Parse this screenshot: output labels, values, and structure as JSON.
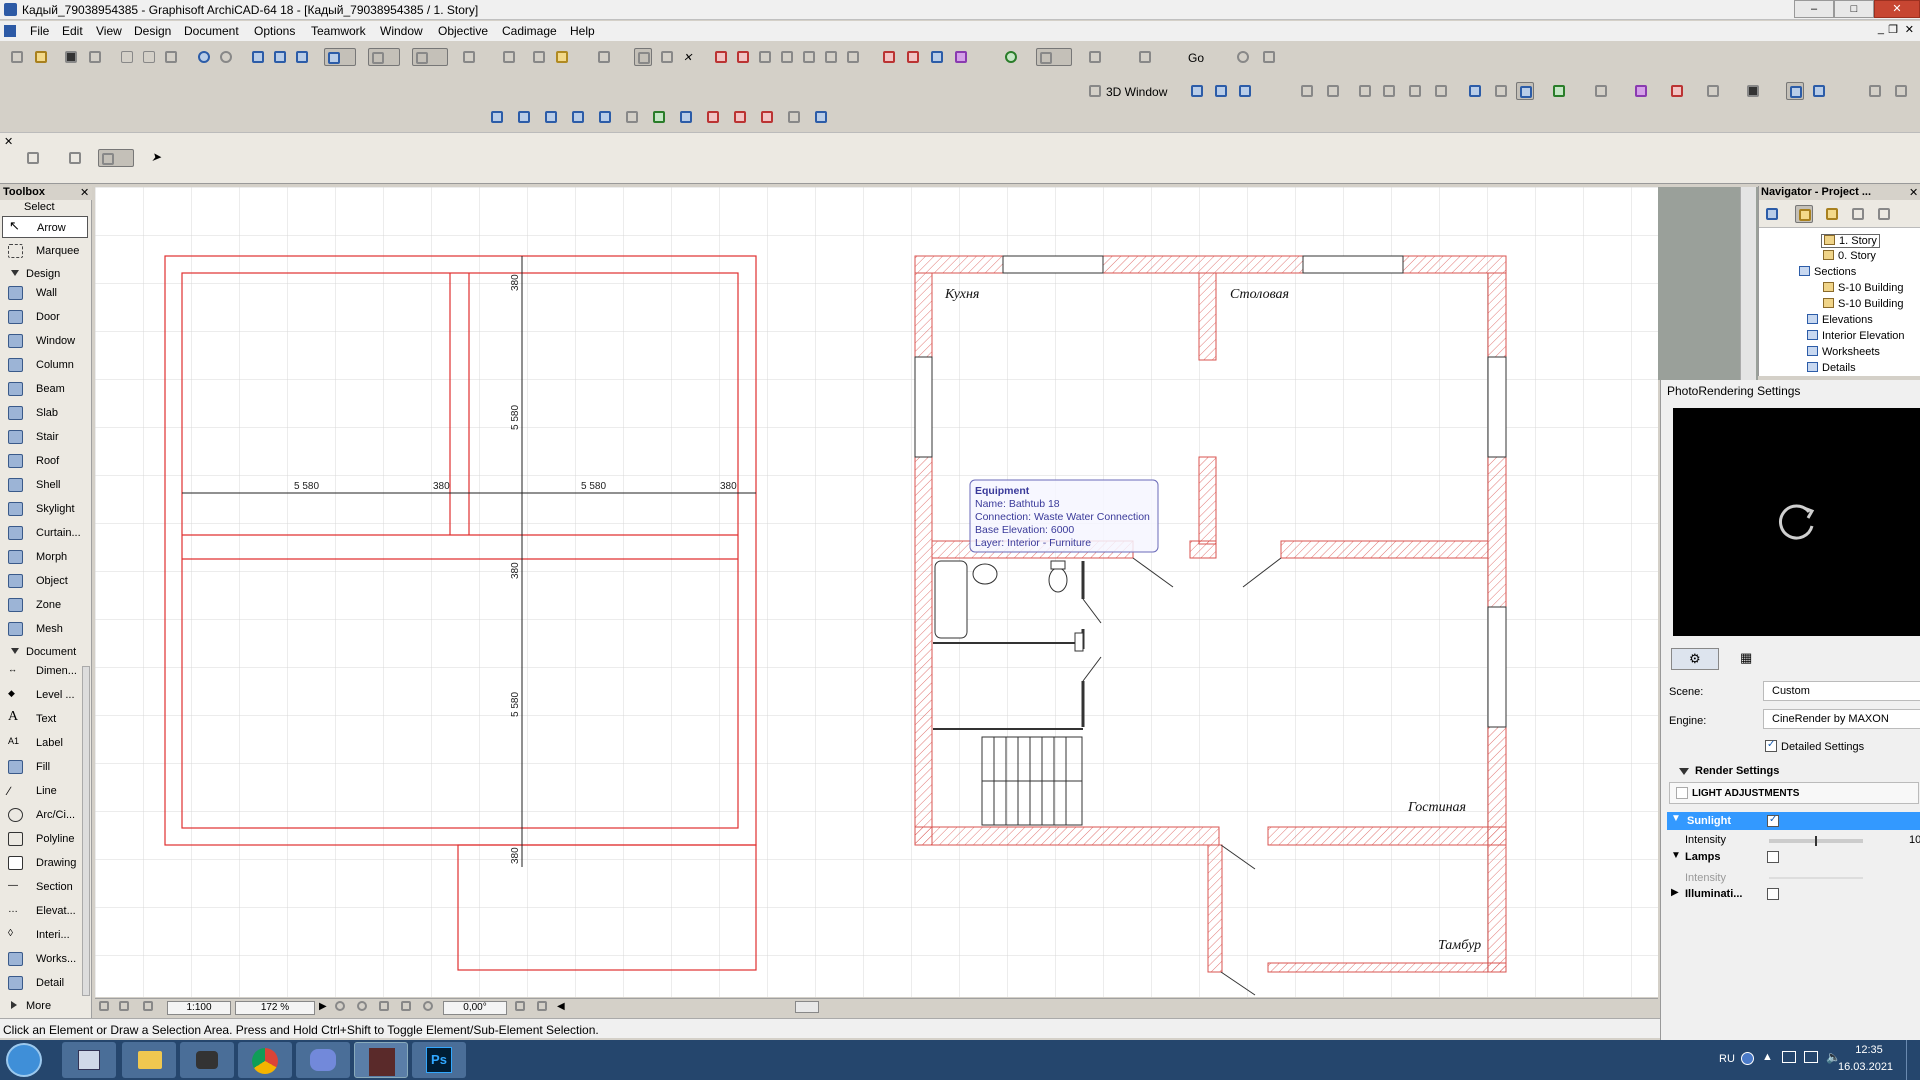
{
  "window": {
    "title": "Кадый_79038954385 - Graphisoft ArchiCAD-64 18 - [Кадый_79038954385 / 1. Story]"
  },
  "menu": [
    "File",
    "Edit",
    "View",
    "Design",
    "Document",
    "Options",
    "Teamwork",
    "Window",
    "Objective",
    "Cadimage",
    "Help"
  ],
  "toolbar": {
    "window3d": "3D Window",
    "go": "Go"
  },
  "toolbox": {
    "title": "Toolbox",
    "select_label": "Select",
    "select_items": [
      "Arrow",
      "Marquee"
    ],
    "design_label": "Design",
    "design_items": [
      "Wall",
      "Door",
      "Window",
      "Column",
      "Beam",
      "Slab",
      "Stair",
      "Roof",
      "Shell",
      "Skylight",
      "Curtain...",
      "Morph",
      "Object",
      "Zone",
      "Mesh"
    ],
    "document_label": "Document",
    "document_items": [
      "Dimen...",
      "Level ...",
      "Text",
      "Label",
      "Fill",
      "Line",
      "Arc/Ci...",
      "Polyline",
      "Drawing",
      "Section",
      "Elevat...",
      "Interi...",
      "Works...",
      "Detail"
    ],
    "more": "More"
  },
  "plan": {
    "dims": {
      "h1": "5 580",
      "h2": "380",
      "h3": "5 580",
      "h4": "380",
      "v1": "380",
      "v2": "5 580",
      "v3": "380",
      "v4": "5 580",
      "v5": "380"
    },
    "rooms": {
      "kitchen": "Кухня",
      "dining": "Столовая",
      "living": "Гостиная",
      "vestibule": "Тамбур"
    },
    "tooltip": {
      "title": "Equipment",
      "name": "Name: Bathtub 18",
      "connection": "Connection: Waste Water Connection",
      "elevation": "Base Elevation: 6000",
      "layer": "Layer: Interior - Furniture"
    }
  },
  "viewbar": {
    "scale": "1:100",
    "zoom": "172 %",
    "angle": "0,00°"
  },
  "status": "Click an Element or Draw a Selection Area. Press and Hold Ctrl+Shift to Toggle Element/Sub-Element Selection.",
  "navigator": {
    "title": "Navigator - Project ...",
    "items": [
      "1. Story",
      "0. Story",
      "Sections",
      "S-10 Building",
      "S-10 Building",
      "Elevations",
      "Interior Elevation",
      "Worksheets",
      "Details"
    ]
  },
  "photo": {
    "title": "PhotoRendering Settings",
    "scene_label": "Scene:",
    "scene_value": "Custom",
    "engine_label": "Engine:",
    "engine_value": "CineRender by MAXON",
    "detailed": "Detailed Settings",
    "render_settings": "Render Settings",
    "light_adj": "LIGHT ADJUSTMENTS",
    "sunlight": "Sunlight",
    "intensity": "Intensity",
    "intensity_value": "10",
    "lamps": "Lamps",
    "lamp_intensity": "Intensity",
    "illumination": "Illuminati..."
  },
  "taskbar": {
    "lang": "RU",
    "time": "12:35",
    "date": "16.03.2021"
  }
}
